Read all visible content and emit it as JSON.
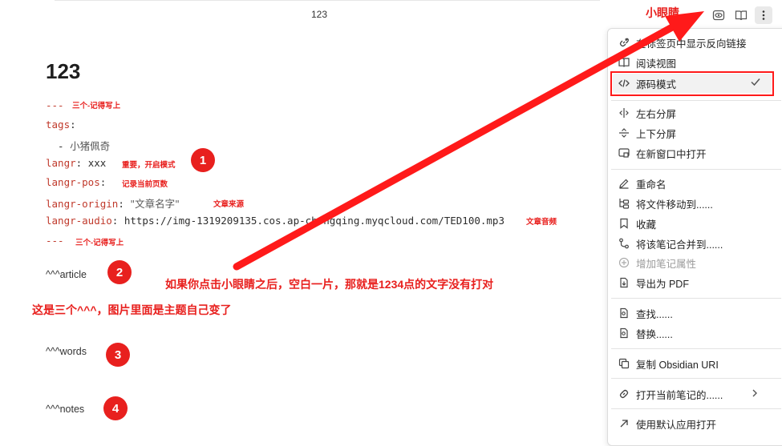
{
  "header": {
    "tab_title": "123",
    "icons": [
      "reading-mode-eye-icon",
      "book-open-icon",
      "more-options-icon"
    ]
  },
  "document": {
    "title": "123",
    "frontmatter_open": "---",
    "tags_key": "tags",
    "tag_item": "小猪佩奇",
    "langr_key": "langr",
    "langr_value": "xxx",
    "langr_pos_key": "langr-pos",
    "langr_origin_key": "langr-origin",
    "langr_origin_value": "\"文章名字\"",
    "langr_audio_key": "langr-audio",
    "langr_audio_value": "https://img-1319209135.cos.ap-chongqing.myqcloud.com/TED100.mp3",
    "frontmatter_close": "---",
    "heading_article": "^^^article",
    "heading_words": "^^^words",
    "heading_notes": "^^^notes"
  },
  "annotations": {
    "three_dash_note_1": "三个-记得写上",
    "three_dash_note_2": "三个-记得写上",
    "langr_note": "重要，开启模式",
    "langr_pos_note": "记录当前页数",
    "origin_note": "文章来源",
    "audio_note": "文章音频",
    "eye_label": "小眼睛",
    "main_note": "如果你点击小眼睛之后，空白一片，那就是1234点的文字没有打对",
    "caret_note": "这是三个^^^，图片里面是主题自己变了",
    "badges": [
      "1",
      "2",
      "3",
      "4"
    ]
  },
  "menu": {
    "items": [
      {
        "label": "在标签页中显示反向链接",
        "icon": "link-icon"
      },
      {
        "label": "阅读视图",
        "icon": "book-icon"
      },
      {
        "label": "源码模式",
        "icon": "code-icon",
        "checked": true
      },
      {
        "label": "左右分屏",
        "icon": "split-vertical-icon"
      },
      {
        "label": "上下分屏",
        "icon": "split-horizontal-icon"
      },
      {
        "label": "在新窗口中打开",
        "icon": "new-window-icon"
      },
      {
        "label": "重命名",
        "icon": "pencil-icon"
      },
      {
        "label": "将文件移动到......",
        "icon": "folder-tree-icon"
      },
      {
        "label": "收藏",
        "icon": "bookmark-icon"
      },
      {
        "label": "将该笔记合并到......",
        "icon": "merge-icon"
      },
      {
        "label": "增加笔记属性",
        "icon": "plus-circle-icon",
        "disabled": true
      },
      {
        "label": "导出为 PDF",
        "icon": "export-icon"
      },
      {
        "label": "查找......",
        "icon": "find-icon"
      },
      {
        "label": "替换......",
        "icon": "replace-icon"
      },
      {
        "label": "复制 Obsidian URI",
        "icon": "copy-icon"
      },
      {
        "label": "打开当前笔记的......",
        "icon": "link-icon"
      },
      {
        "label": "使用默认应用打开",
        "icon": "arrow-up-right-icon"
      }
    ]
  },
  "colors": {
    "annotation_red": "#e8201e",
    "frontmatter_key": "#c0392b",
    "menu_border": "#dcdcdc"
  }
}
